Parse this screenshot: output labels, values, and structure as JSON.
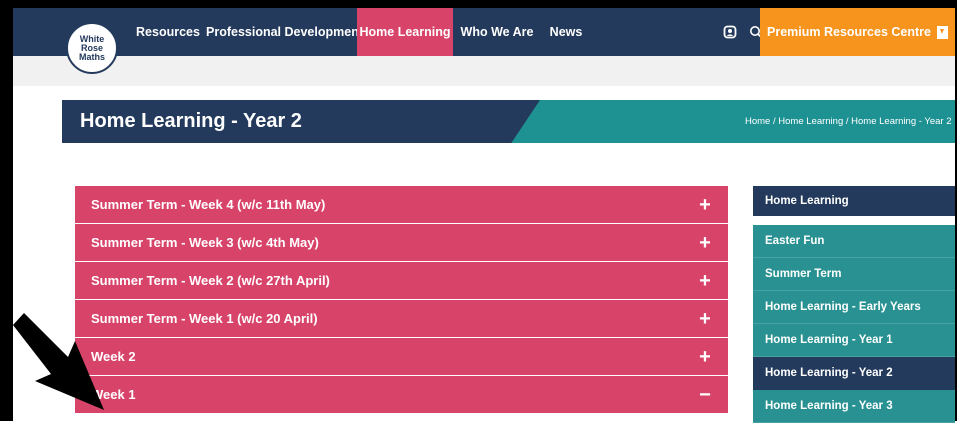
{
  "logo": {
    "line1": "White",
    "line2": "Rose",
    "line3": "Maths"
  },
  "nav": {
    "items": [
      {
        "label": "Resources"
      },
      {
        "label": "Professional Development"
      },
      {
        "label": "Home Learning",
        "active": true
      },
      {
        "label": "Who We Are"
      },
      {
        "label": "News"
      }
    ],
    "premium_label": "Premium Resources Centre",
    "icons": [
      "account-icon",
      "search-icon",
      "download-icon"
    ]
  },
  "page": {
    "title": "Home Learning - Year 2",
    "breadcrumb": [
      "Home",
      "Home Learning",
      "Home Learning - Year 2"
    ],
    "breadcrumb_sep": " / "
  },
  "accordion": [
    {
      "label": "Summer Term - Week 4 (w/c 11th May)",
      "toggle": "+"
    },
    {
      "label": "Summer Term - Week 3 (w/c 4th May)",
      "toggle": "+"
    },
    {
      "label": "Summer Term - Week 2 (w/c 27th April)",
      "toggle": "+"
    },
    {
      "label": "Summer Term - Week 1 (w/c 20 April)",
      "toggle": "+"
    },
    {
      "label": "Week 2",
      "toggle": "+"
    },
    {
      "label": "Week 1",
      "toggle": "−",
      "expanded": true
    }
  ],
  "sidebar": {
    "heading": "Home Learning",
    "items": [
      {
        "label": "Easter Fun"
      },
      {
        "label": "Summer Term"
      },
      {
        "label": "Home Learning - Early Years"
      },
      {
        "label": "Home Learning - Year 1"
      },
      {
        "label": "Home Learning - Year 2",
        "active": true
      },
      {
        "label": "Home Learning - Year 3"
      }
    ]
  },
  "colors": {
    "navy": "#243a5c",
    "pink": "#d8436a",
    "teal": "#1e9293",
    "orange": "#f7941d"
  }
}
